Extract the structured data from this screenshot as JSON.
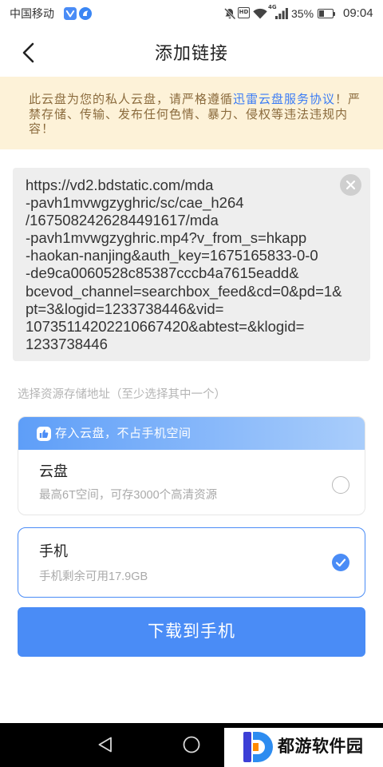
{
  "status_bar": {
    "carrier": "中国移动",
    "hd": "HD",
    "network": "4G",
    "battery": "35%",
    "battery_level": 0.35,
    "time": "09:04",
    "icons": [
      "app-notification-icon",
      "browser-notification-icon",
      "mute-icon",
      "wifi-icon",
      "signal-icon",
      "battery-icon"
    ]
  },
  "header": {
    "title": "添加链接",
    "back_icon": "chevron-left-icon"
  },
  "notice": {
    "text_before": "此云盘为您的私人云盘，请严格遵循",
    "link_text": "迅雷云盘服务协议",
    "text_after": "！严禁存储、传输、发布任何色情、暴力、侵权等违法违规内容！"
  },
  "link_input": {
    "lines": [
      "https://vd2.bdstatic.com/mda",
      "-pavh1mvwgzyghric/sc/cae_h264",
      "/1675082426284491617/mda",
      "-pavh1mvwgzyghric.mp4?v_from_s=hkapp",
      "-haokan-nanjing&auth_key=1675165833-0-0",
      "-de9ca0060528c85387cccb4a7615eadd&",
      "bcevod_channel=searchbox_feed&cd=0&pd=1&",
      "pt=3&logid=1233738446&vid=",
      "10735114202210667420&abtest=&klogid=",
      "1233738446"
    ],
    "clear_icon": "clear-icon"
  },
  "storage": {
    "label": "选择资源存储地址（至少选择其中一个）",
    "cloud": {
      "promo_icon": "thumbs-up-icon",
      "promo_text": "存入云盘，不占手机空间",
      "title": "云盘",
      "description": "最高6T空间，可存3000个高清资源",
      "selected": false
    },
    "phone": {
      "title": "手机",
      "description": "手机剩余可用17.9GB",
      "selected": true
    }
  },
  "download_button": {
    "label": "下载到手机"
  },
  "nav_bar": {
    "icons": [
      "back-triangle-icon",
      "home-circle-icon"
    ]
  },
  "watermark": {
    "text": "都游软件园",
    "logo_icon": "duyou-logo-icon"
  },
  "colors": {
    "accent": "#4a8cf6",
    "notice_bg": "#fdf2d8",
    "notice_text": "#8b6b3d",
    "link": "#3b7cf5",
    "input_bg": "#eeeeee"
  }
}
